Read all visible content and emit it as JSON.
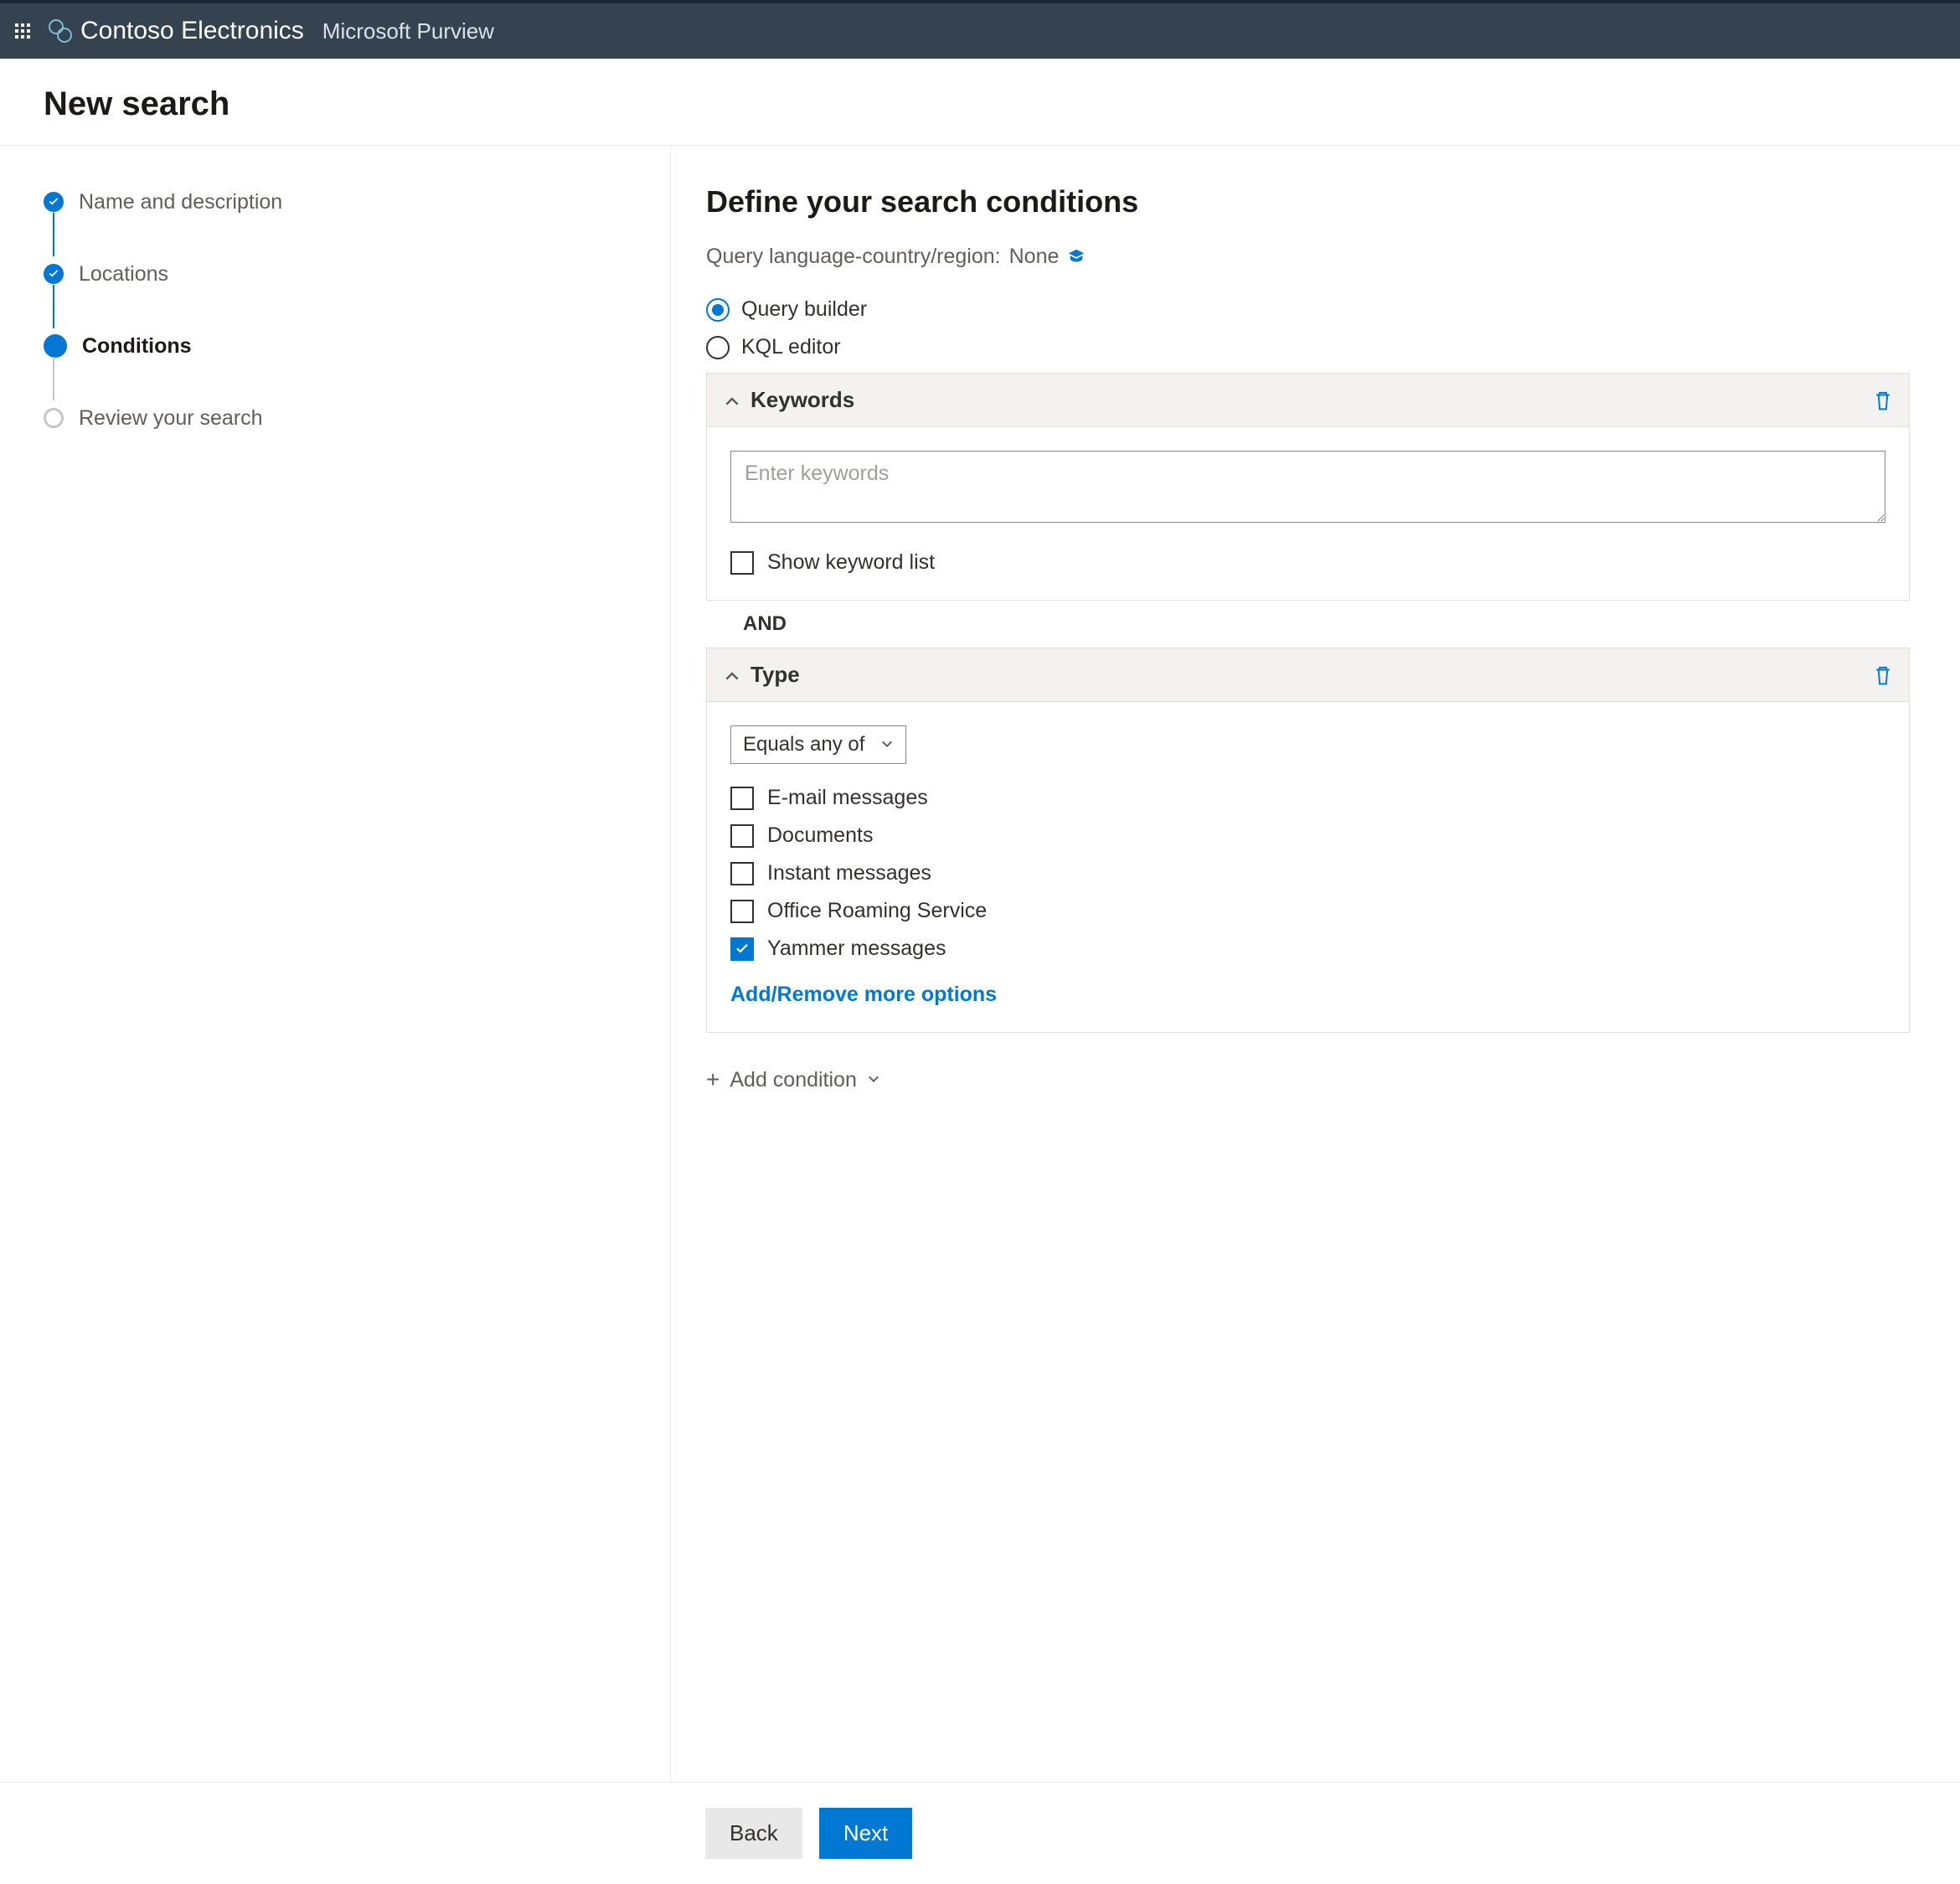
{
  "header": {
    "org": "Contoso Electronics",
    "product": "Microsoft Purview"
  },
  "page_title": "New search",
  "steps": [
    {
      "label": "Name and description",
      "state": "completed"
    },
    {
      "label": "Locations",
      "state": "completed"
    },
    {
      "label": "Conditions",
      "state": "current"
    },
    {
      "label": "Review your search",
      "state": "future"
    }
  ],
  "main": {
    "heading": "Define your search conditions",
    "query_lang_label": "Query language-country/region:",
    "query_lang_value": "None",
    "builder_options": [
      {
        "label": "Query builder",
        "selected": true
      },
      {
        "label": "KQL editor",
        "selected": false
      }
    ],
    "keywords_card": {
      "title": "Keywords",
      "placeholder": "Enter keywords",
      "show_list_label": "Show keyword list"
    },
    "and_label": "AND",
    "type_card": {
      "title": "Type",
      "operator": "Equals any of",
      "options": [
        {
          "label": "E-mail messages",
          "checked": false
        },
        {
          "label": "Documents",
          "checked": false
        },
        {
          "label": "Instant messages",
          "checked": false
        },
        {
          "label": "Office Roaming Service",
          "checked": false
        },
        {
          "label": "Yammer messages",
          "checked": true
        }
      ],
      "more_link": "Add/Remove more options"
    },
    "add_condition": "Add condition"
  },
  "footer": {
    "back": "Back",
    "next": "Next"
  }
}
